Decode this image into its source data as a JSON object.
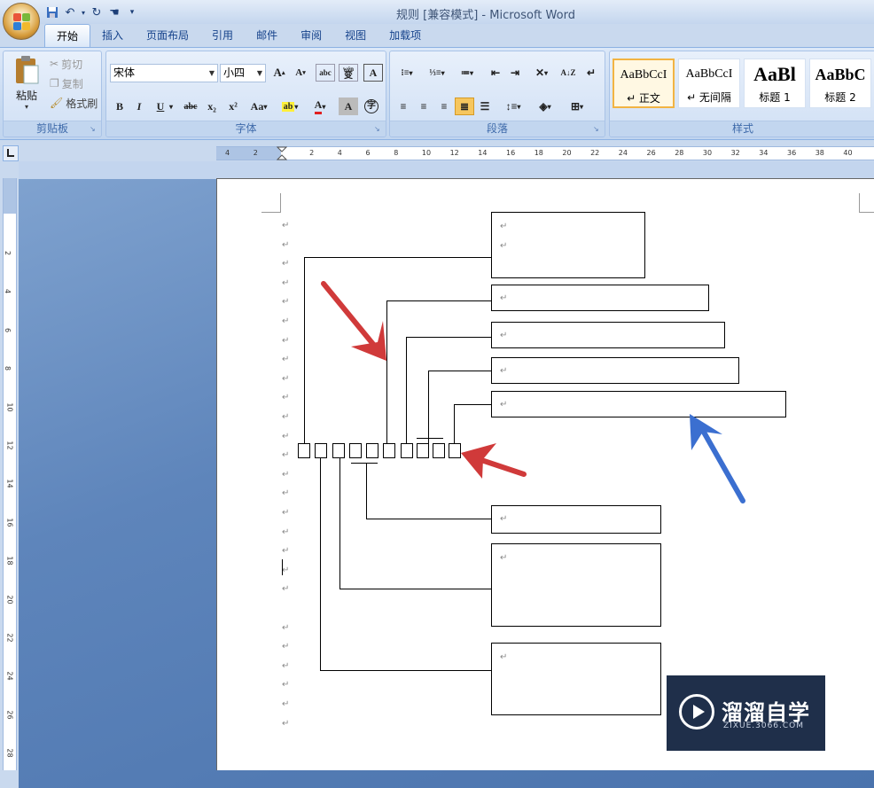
{
  "window": {
    "title": "规则 [兼容模式] - Microsoft Word"
  },
  "qat": {
    "save": "save-icon",
    "undo": "undo-icon",
    "redo": "redo-icon",
    "customize": "▾"
  },
  "tabs": [
    {
      "label": "开始",
      "active": true
    },
    {
      "label": "插入"
    },
    {
      "label": "页面布局"
    },
    {
      "label": "引用"
    },
    {
      "label": "邮件"
    },
    {
      "label": "审阅"
    },
    {
      "label": "视图"
    },
    {
      "label": "加载项"
    }
  ],
  "clipboard": {
    "group": "剪贴板",
    "paste": "粘贴",
    "cut": "剪切",
    "copy": "复制",
    "format_painter": "格式刷"
  },
  "font": {
    "group": "字体",
    "family": "宋体",
    "size": "小四",
    "bold": "B",
    "italic": "I",
    "underline": "U",
    "strike": "abc",
    "sub": "x₂",
    "sup": "x²",
    "case": "Aa",
    "grow": "A",
    "shrink": "A",
    "phonetic": "wén",
    "clear": "A",
    "border": "A"
  },
  "paragraph": {
    "group": "段落"
  },
  "styles": {
    "group": "样式",
    "tiles": [
      {
        "sample": "AaBbCcI",
        "name": "↵ 正文"
      },
      {
        "sample": "AaBbCcI",
        "name": "↵ 无间隔"
      },
      {
        "sample": "AaBl",
        "name": "标题 1"
      },
      {
        "sample": "AaBbC",
        "name": "标题 2"
      }
    ]
  },
  "ruler": {
    "h_ticks": [
      "4",
      "2",
      "",
      "2",
      "4",
      "6",
      "8",
      "10",
      "12",
      "14",
      "16",
      "18",
      "20",
      "22",
      "24",
      "26",
      "28",
      "30",
      "32",
      "34",
      "36",
      "38",
      "40"
    ],
    "v_ticks": [
      "2",
      "4",
      "6",
      "8",
      "10",
      "12",
      "14",
      "16",
      "18",
      "20",
      "22",
      "24",
      "26",
      "28"
    ]
  },
  "document": {
    "para_mark": "↵"
  },
  "watermark": {
    "name": "溜溜自学",
    "url": "ZIXUE.3066.COM"
  },
  "colors": {
    "red_arrow": "#d03a3a",
    "blue_arrow": "#3b6fd0"
  }
}
